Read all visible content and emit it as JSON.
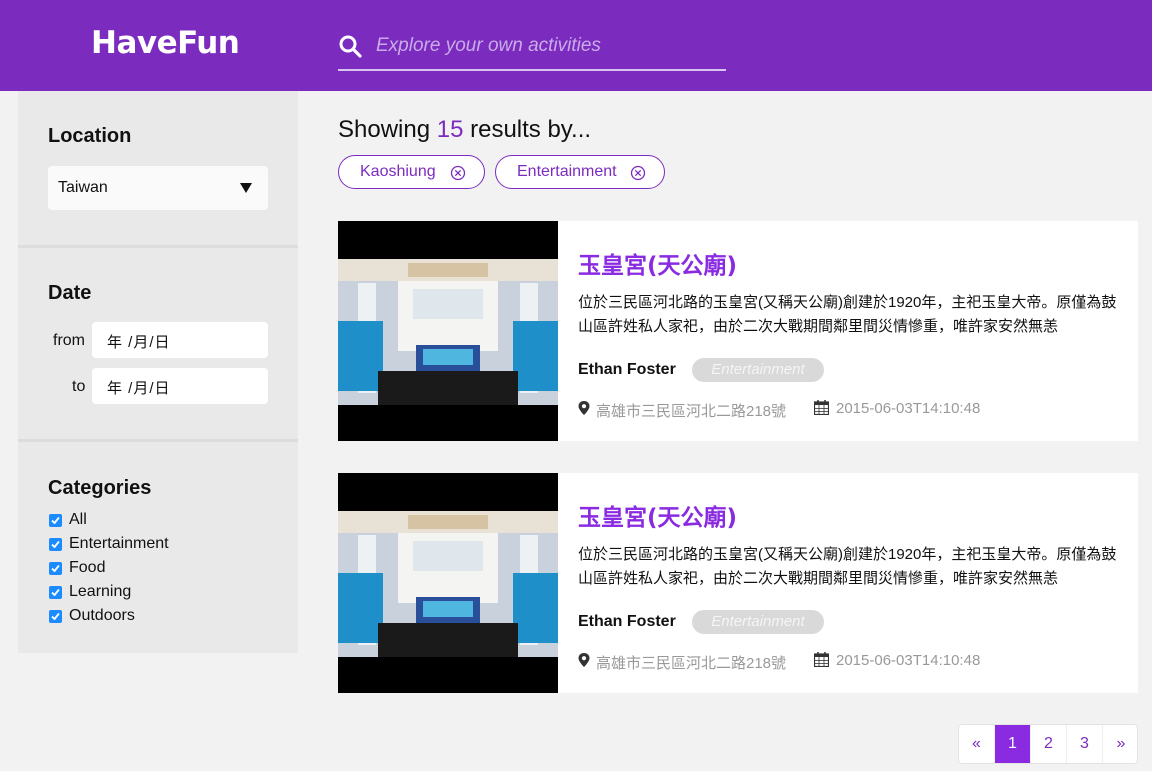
{
  "header": {
    "logo": "HaveFun",
    "search_placeholder": "Explore your own activities"
  },
  "sidebar": {
    "location": {
      "title": "Location",
      "selected": "Taiwan"
    },
    "date": {
      "title": "Date",
      "from_label": "from",
      "to_label": "to",
      "from_value": "年 /月/日",
      "to_value": "年 /月/日"
    },
    "categories": {
      "title": "Categories",
      "items": [
        {
          "label": "All",
          "checked": true
        },
        {
          "label": "Entertainment",
          "checked": true
        },
        {
          "label": "Food",
          "checked": true
        },
        {
          "label": "Learning",
          "checked": true
        },
        {
          "label": "Outdoors",
          "checked": true
        }
      ]
    }
  },
  "results": {
    "prefix": "Showing ",
    "count": "15",
    "suffix": " results by...",
    "filters": [
      {
        "label": "Kaoshiung"
      },
      {
        "label": "Entertainment"
      }
    ]
  },
  "cards": [
    {
      "title": "玉皇宮(天公廟)",
      "description": "位於三民區河北路的玉皇宮(又稱天公廟)創建於1920年，主祀玉皇大帝。原僅為鼓山區許姓私人家祀，由於二次大戰期間鄰里間災情慘重，唯許家安然無恙",
      "author": "Ethan Foster",
      "tag": "Entertainment",
      "address": "高雄市三民區河北二路218號",
      "datetime": "2015-06-03T14:10:48"
    },
    {
      "title": "玉皇宮(天公廟)",
      "description": "位於三民區河北路的玉皇宮(又稱天公廟)創建於1920年，主祀玉皇大帝。原僅為鼓山區許姓私人家祀，由於二次大戰期間鄰里間災情慘重，唯許家安然無恙",
      "author": "Ethan Foster",
      "tag": "Entertainment",
      "address": "高雄市三民區河北二路218號",
      "datetime": "2015-06-03T14:10:48"
    }
  ],
  "pagination": {
    "prev": "«",
    "pages": [
      "1",
      "2",
      "3"
    ],
    "active": "1",
    "next": "»"
  },
  "colors": {
    "brand": "#7b2cbf",
    "accent": "#8a2be2",
    "checkbox": "#1a8cff"
  }
}
